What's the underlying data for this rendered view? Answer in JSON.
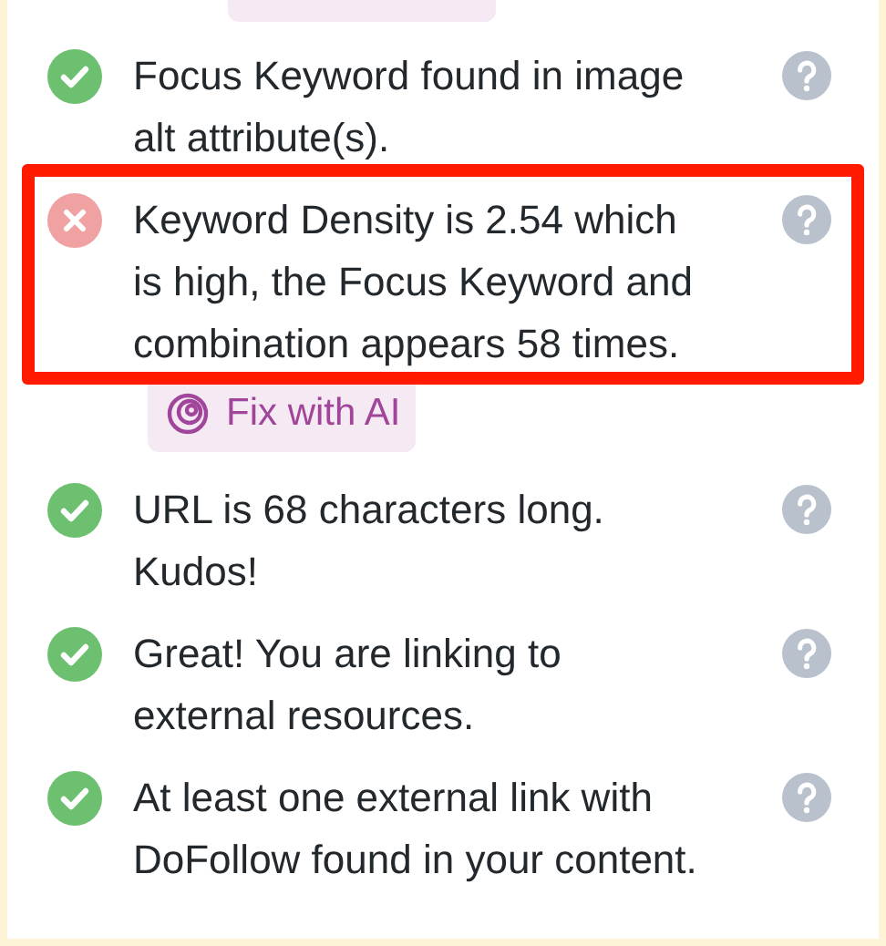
{
  "checks": [
    {
      "passed": true,
      "text": "Focus Keyword found in image alt attribute(s).",
      "highlighted": false
    },
    {
      "passed": false,
      "text": "Keyword Density is 2.54 which is high, the Focus Keyword and combination appears 58 times.",
      "highlighted": true,
      "action": "Fix with AI"
    },
    {
      "passed": true,
      "text": "URL is 68 characters long. Kudos!",
      "highlighted": false
    },
    {
      "passed": true,
      "text": "Great! You are linking to external resources.",
      "highlighted": false
    },
    {
      "passed": true,
      "text": "At least one external link with DoFollow found in your content.",
      "highlighted": false
    }
  ]
}
